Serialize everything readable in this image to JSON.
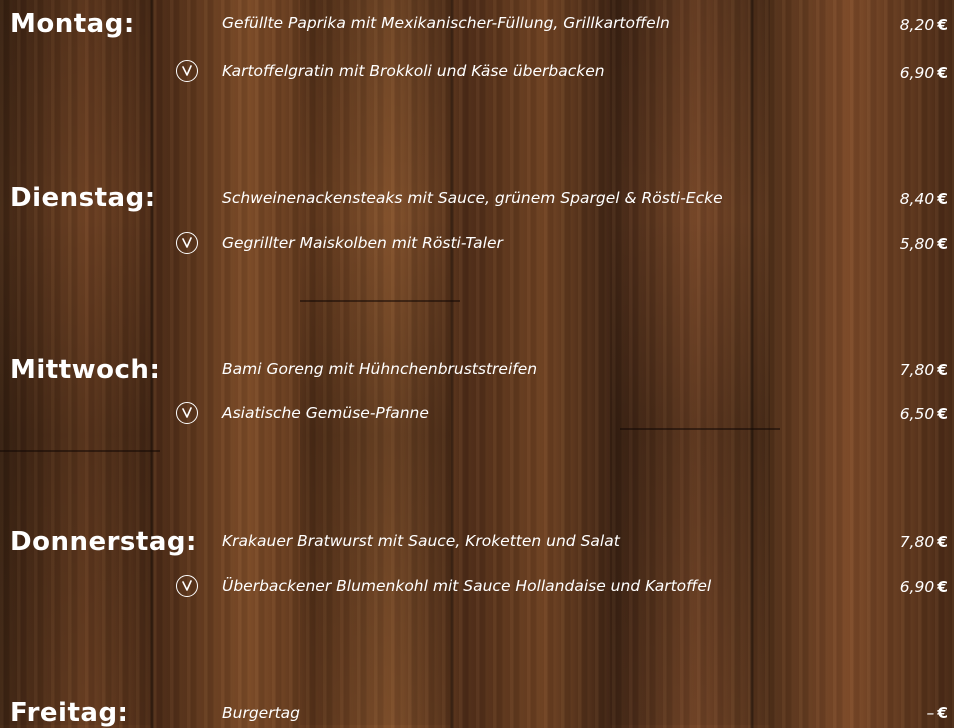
{
  "menu": {
    "days": [
      {
        "label": "Montag:",
        "main": {
          "dish": "Gefüllte Paprika mit Mexikanischer-Füllung, Grillkartoffeln",
          "price": "8,20"
        },
        "veg": {
          "dish": "Kartoffelgratin mit Brokkoli und Käse überbacken",
          "price": "6,90"
        }
      },
      {
        "label": "Dienstag:",
        "main": {
          "dish": "Schweinenackensteaks mit Sauce, grünem Spargel & Rösti-Ecke",
          "price": "8,40"
        },
        "veg": {
          "dish": "Gegrillter Maiskolben mit Rösti-Taler",
          "price": "5,80"
        }
      },
      {
        "label": "Mittwoch:",
        "main": {
          "dish": "Bami Goreng mit Hühnchenbruststreifen",
          "price": "7,80"
        },
        "veg": {
          "dish": "Asiatische Gemüse-Pfanne",
          "price": "6,50"
        }
      },
      {
        "label": "Donnerstag:",
        "main": {
          "dish": "Krakauer Bratwurst mit Sauce, Kroketten und Salat",
          "price": "7,80"
        },
        "veg": {
          "dish": "Überbackener Blumenkohl mit Sauce Hollandaise und Kartoffel",
          "price": "6,90"
        }
      },
      {
        "label": "Freitag:",
        "main": {
          "dish": "Burgertag",
          "price": "–"
        }
      }
    ],
    "currency": "€",
    "veg_icon": "vegetarian-leaf-icon"
  },
  "colors": {
    "text": "#ffffff",
    "wood_dark": "#3e2413",
    "wood_mid": "#6b3f22",
    "wood_light": "#81502b"
  }
}
